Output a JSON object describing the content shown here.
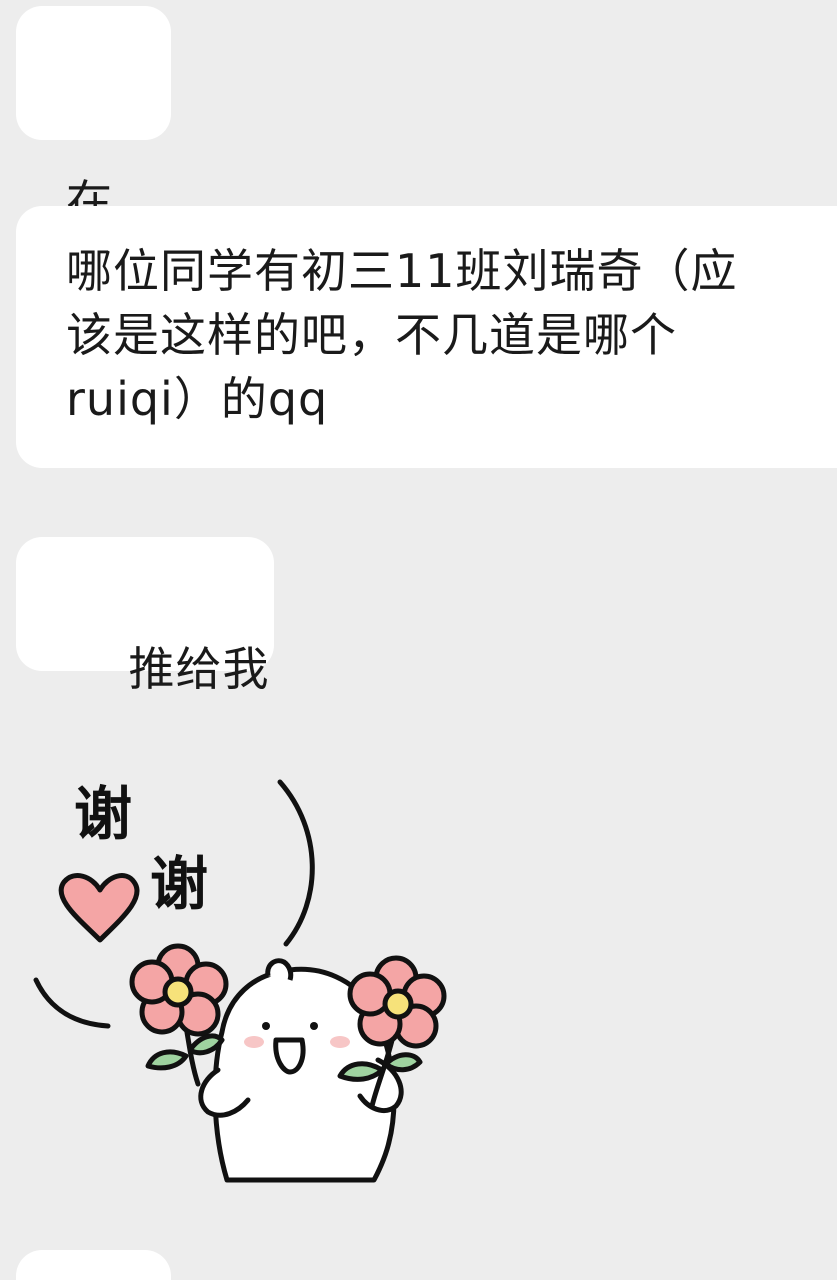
{
  "messages": [
    {
      "text": "在"
    },
    {
      "lines": [
        "哪位同学有初三11班刘瑞奇（应",
        "该是这样的吧，不几道是哪个",
        "ruiqi）的qq"
      ]
    },
    {
      "text": "推给我"
    }
  ],
  "sticker": {
    "text_1": "谢",
    "text_2": "谢",
    "icon": "thank-you-bear-with-flowers-sticker"
  },
  "colors": {
    "background": "#ededed",
    "bubble": "#ffffff",
    "flower": "#f4a5a5",
    "heart": "#f4a5a5",
    "leaf": "#9fd3a0"
  }
}
